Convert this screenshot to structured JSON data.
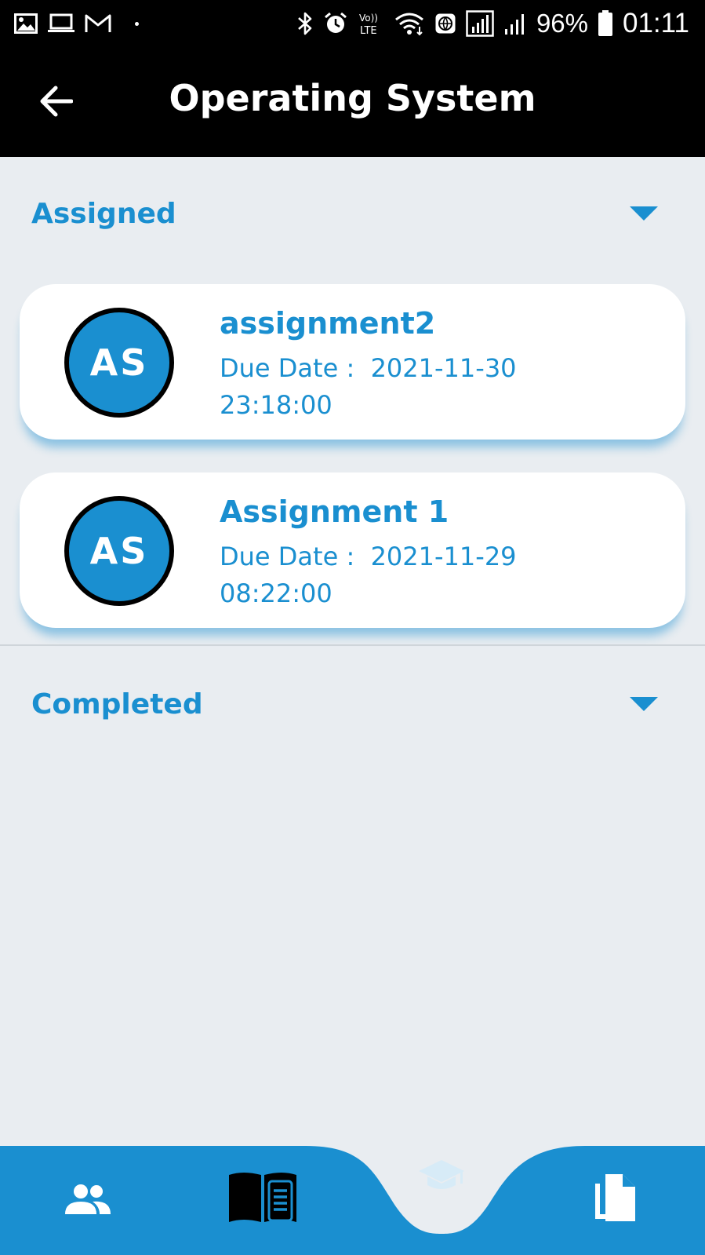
{
  "status_bar": {
    "left_icons": [
      "image-icon",
      "laptop-icon",
      "gmail-icon",
      "dot-icon"
    ],
    "right_icons": [
      "bluetooth-icon",
      "alarm-icon",
      "volte-icon",
      "wifi-icon",
      "vpn-icon",
      "signal-sim1-icon",
      "signal-sim2-icon"
    ],
    "volte_line1": "Vo))",
    "volte_line2": "LTE",
    "battery_percent": "96%",
    "battery_icon": "battery-icon",
    "time": "01:11"
  },
  "app_bar": {
    "back_icon": "arrow-left-icon",
    "title": "Operating System"
  },
  "sections": {
    "assigned": {
      "title": "Assigned",
      "toggle_icon": "caret-down-icon",
      "items": [
        {
          "avatar_text": "AS",
          "title": "assignment2",
          "due": "Due Date :  2021-11-30\n23:18:00"
        },
        {
          "avatar_text": "AS",
          "title": "Assignment 1",
          "due": "Due Date :  2021-11-29\n08:22:00"
        }
      ]
    },
    "completed": {
      "title": "Completed",
      "toggle_icon": "caret-down-icon"
    }
  },
  "bottom_nav": {
    "items": [
      "people-icon",
      "book-icon",
      "graduation-cap-icon",
      "documents-icon"
    ],
    "active_item": "book-icon",
    "color": "#1a8fd0"
  },
  "colors": {
    "accent": "#1a8fd0",
    "background": "#e9edf1",
    "header": "#000000",
    "card": "#ffffff"
  }
}
